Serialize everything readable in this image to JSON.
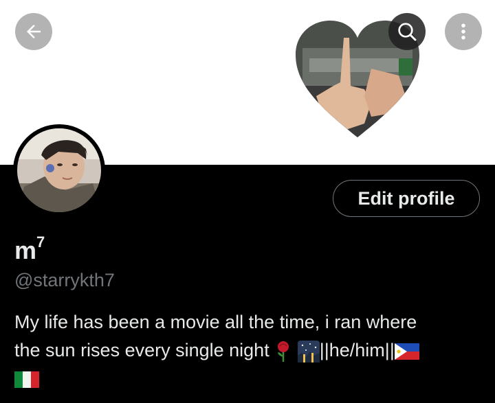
{
  "header": {
    "back_icon": "arrow-left-icon",
    "search_icon": "search-icon",
    "more_icon": "more-vertical-icon"
  },
  "profile": {
    "edit_button_label": "Edit profile",
    "display_name": "m",
    "display_name_superscript": "7",
    "handle": "@starrykth7",
    "bio_line1": "My life has been a movie all the time, i ran where",
    "bio_line2_text": "the sun rises every single night",
    "bio_pronouns": "||he/him||",
    "bio_emojis": [
      "rose-emoji",
      "night-sky-emoji",
      "philippines-flag-emoji",
      "italy-flag-emoji"
    ]
  },
  "colors": {
    "background": "#000000",
    "banner": "#ffffff",
    "text_primary": "#e7e9ea",
    "text_secondary": "#71767b",
    "button_border": "#6e767d"
  }
}
